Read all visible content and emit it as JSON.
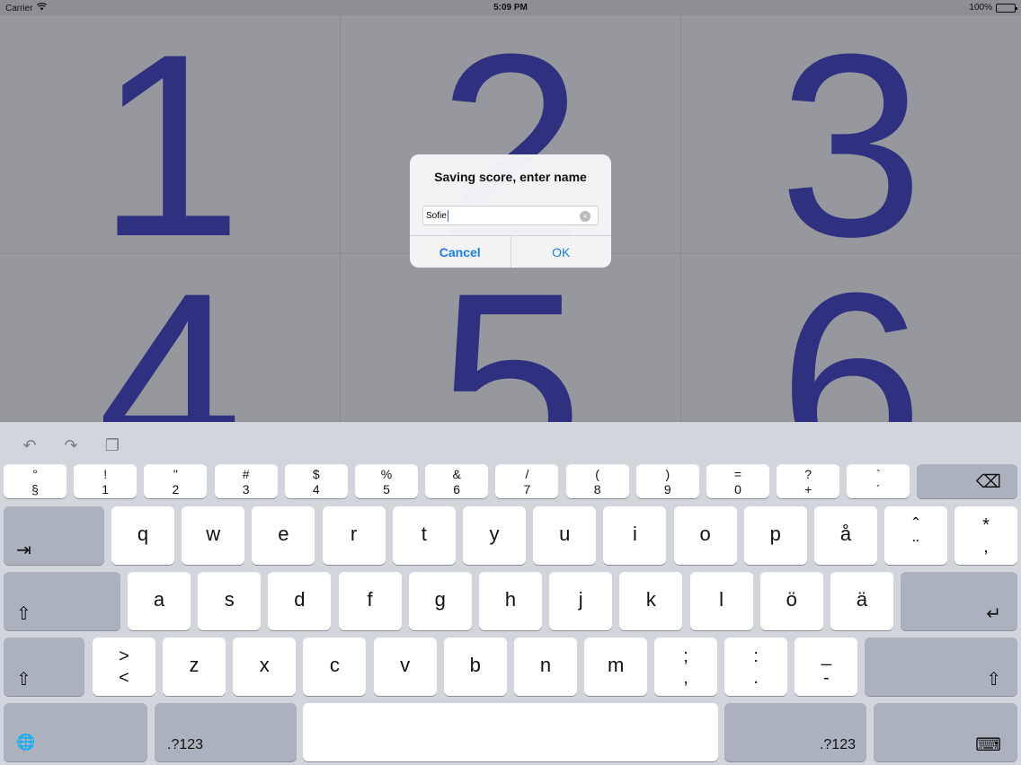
{
  "status": {
    "carrier": "Carrier",
    "time": "5:09 PM",
    "battery": "100%"
  },
  "grid": {
    "numbers": [
      "1",
      "2",
      "3",
      "4",
      "5",
      "6"
    ]
  },
  "alert": {
    "title": "Saving score, enter name",
    "value": "Sofie",
    "cancel": "Cancel",
    "ok": "OK"
  },
  "keyboard": {
    "toolbar": [
      "undo-icon",
      "redo-icon",
      "paste-icon"
    ],
    "num_row": [
      {
        "top": "°",
        "bot": "§"
      },
      {
        "top": "!",
        "bot": "1"
      },
      {
        "top": "\"",
        "bot": "2"
      },
      {
        "top": "#",
        "bot": "3"
      },
      {
        "top": "$",
        "bot": "4"
      },
      {
        "top": "%",
        "bot": "5"
      },
      {
        "top": "&",
        "bot": "6"
      },
      {
        "top": "/",
        "bot": "7"
      },
      {
        "top": "(",
        "bot": "8"
      },
      {
        "top": ")",
        "bot": "9"
      },
      {
        "top": "=",
        "bot": "0"
      },
      {
        "top": "?",
        "bot": "+"
      },
      {
        "top": "`",
        "bot": "´"
      }
    ],
    "row1": [
      "q",
      "w",
      "e",
      "r",
      "t",
      "y",
      "u",
      "i",
      "o",
      "p",
      "å"
    ],
    "row1_pairs": [
      {
        "top": "ˆ",
        "bot": "¨"
      },
      {
        "top": "*",
        "bot": ","
      }
    ],
    "row2": [
      "a",
      "s",
      "d",
      "f",
      "g",
      "h",
      "j",
      "k",
      "l",
      "ö",
      "ä"
    ],
    "row3_lead": {
      "top": ">",
      "bot": "<"
    },
    "row3": [
      "z",
      "x",
      "c",
      "v",
      "b",
      "n",
      "m"
    ],
    "row3_pairs": [
      {
        "top": ";",
        "bot": ","
      },
      {
        "top": ":",
        "bot": "."
      },
      {
        "top": "_",
        "bot": "-"
      }
    ],
    "numbers_label": ".?123",
    "numbers_label_right": ".?123",
    "tab_glyph": "⇥",
    "shift_glyph": "⇧",
    "return_glyph": "↵",
    "delete_glyph": "⌫",
    "globe_glyph": "🌐",
    "hide_glyph": "⌨"
  }
}
